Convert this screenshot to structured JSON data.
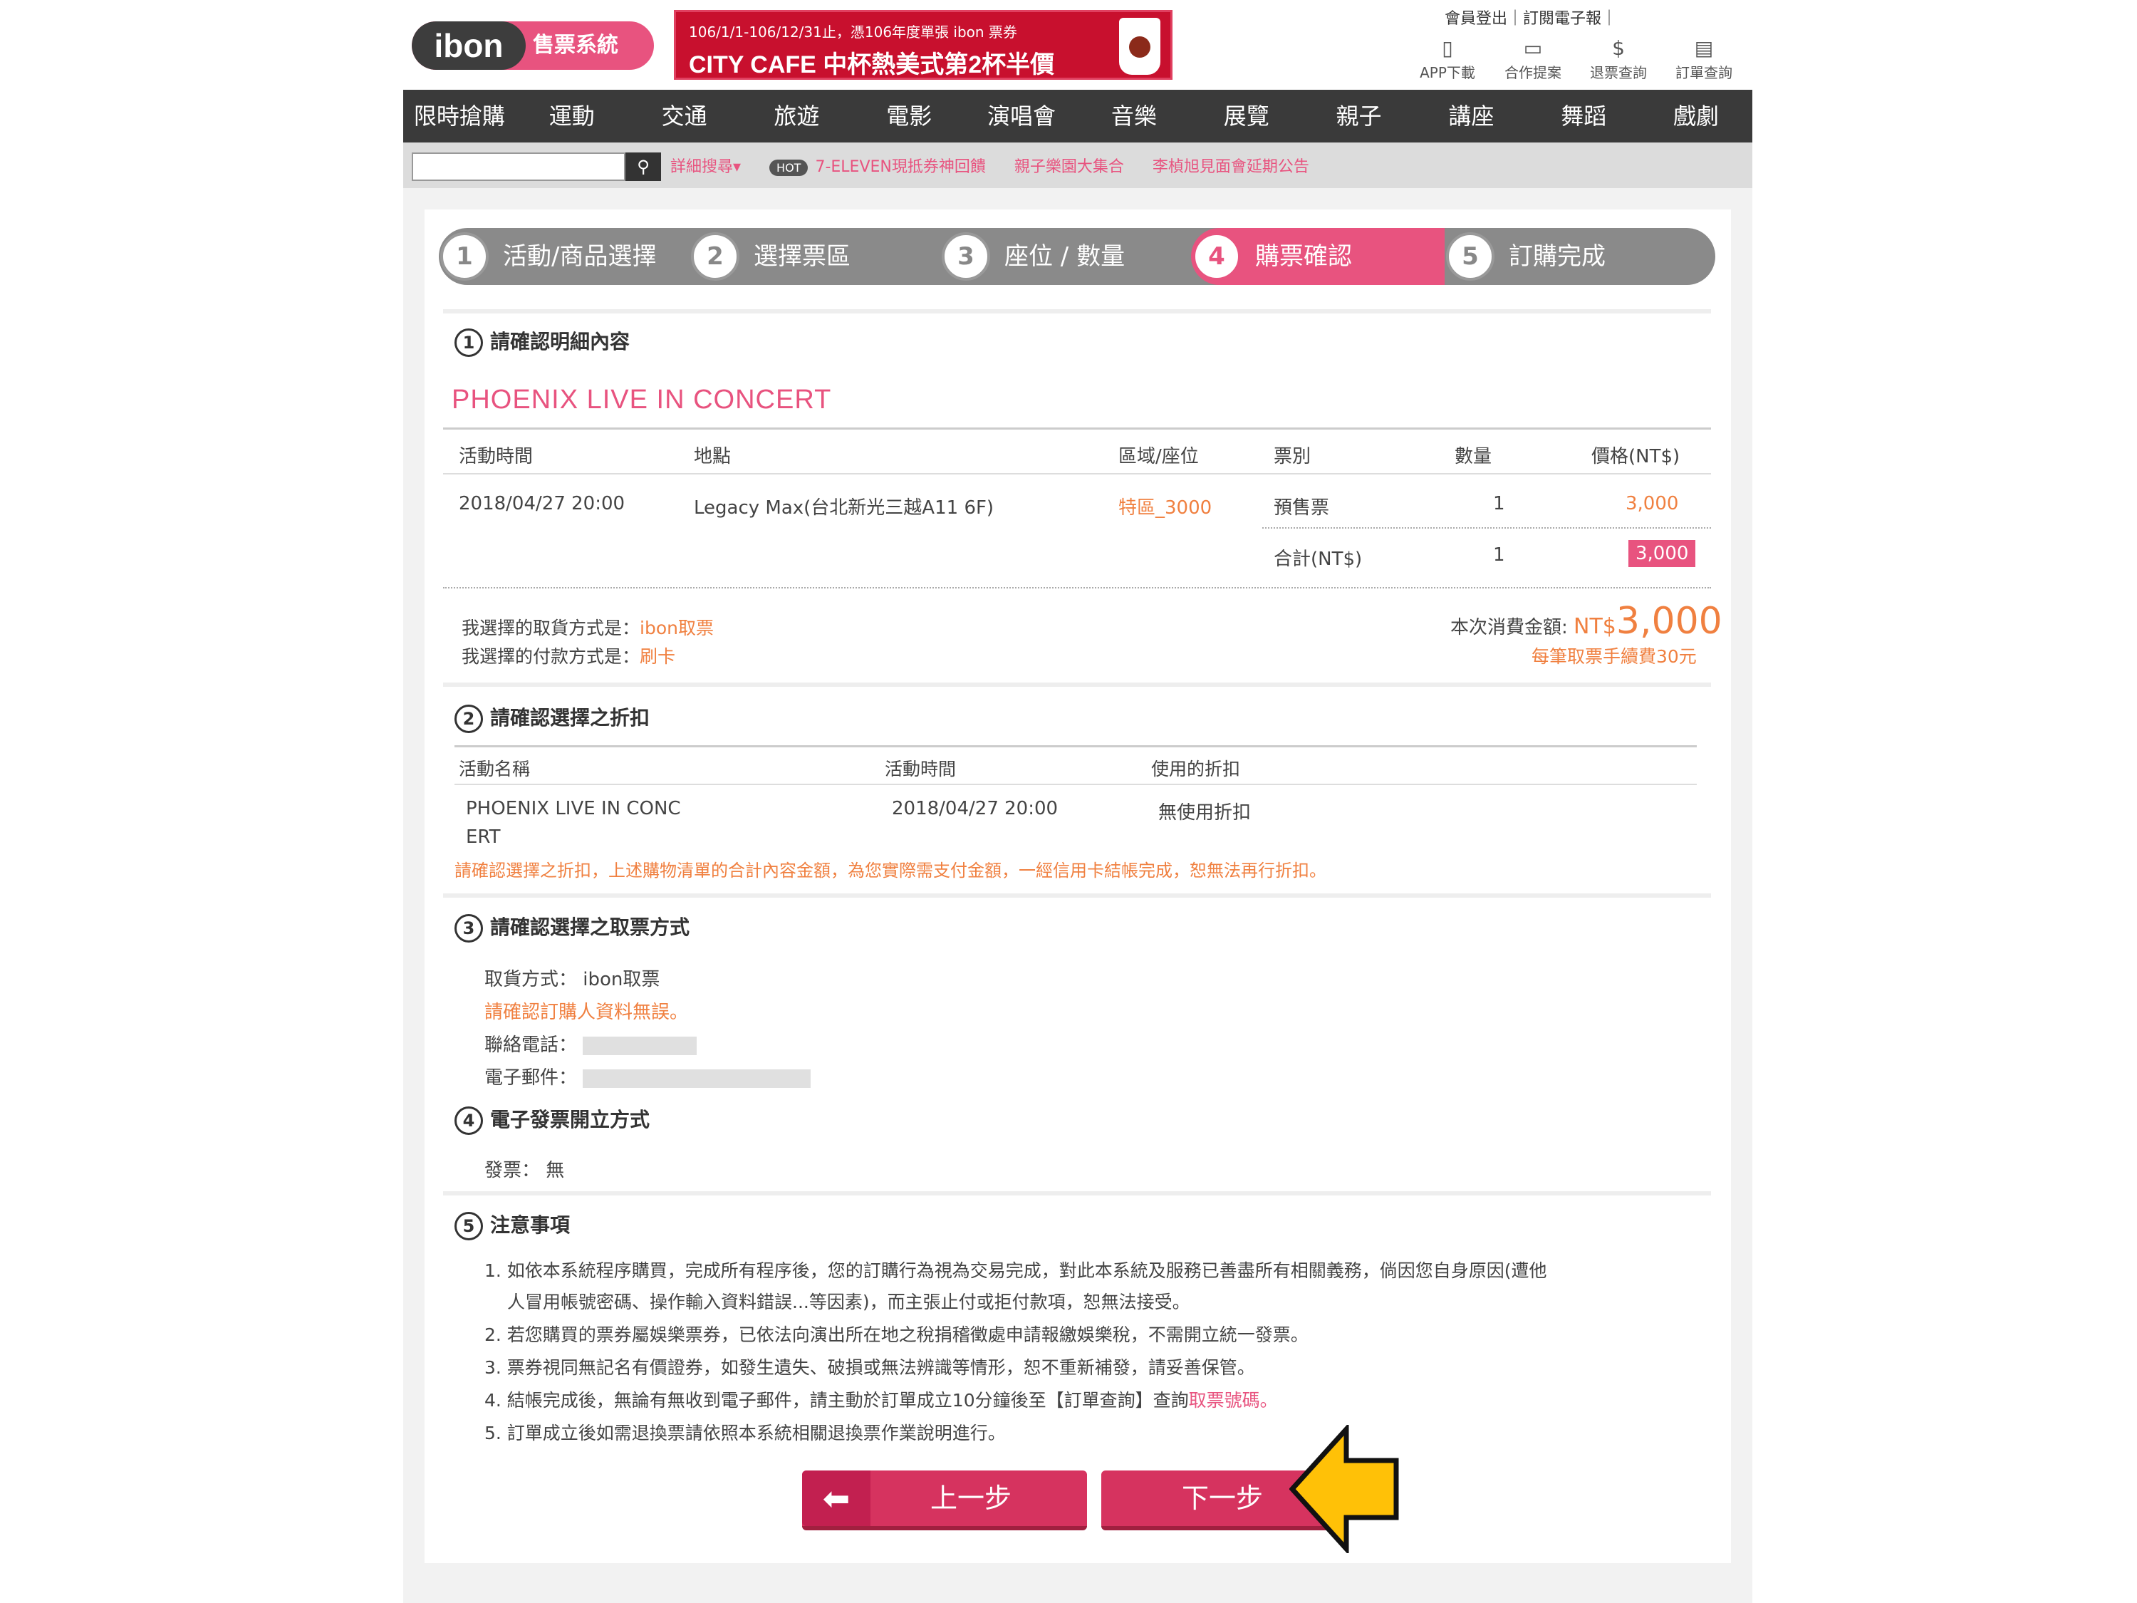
{
  "header": {
    "logo_ibon": "ibon",
    "logo_system": "售票系統",
    "banner_small": "106/1/1-106/12/31止，憑106年度單張 ibon 票券",
    "banner_big": "CITY CAFE 中杯熱美式第2杯半價",
    "top_links": "會員登出｜訂閱電子報｜",
    "top_icons": [
      {
        "icon": "phone-icon",
        "label": "APP下載"
      },
      {
        "icon": "briefcase-icon",
        "label": "合作提案"
      },
      {
        "icon": "refund-icon",
        "label": "退票查詢"
      },
      {
        "icon": "document-icon",
        "label": "訂單查詢"
      }
    ]
  },
  "nav": {
    "items": [
      "限時搶購",
      "運動",
      "交通",
      "旅遊",
      "電影",
      "演唱會",
      "音樂",
      "展覽",
      "親子",
      "講座",
      "舞蹈",
      "戲劇"
    ]
  },
  "search": {
    "placeholder": "",
    "advanced": "詳細搜尋▾",
    "hot_badge": "HOT",
    "links": [
      "7-ELEVEN現抵券神回饋",
      "親子樂園大集合",
      "李楨旭見面會延期公告"
    ]
  },
  "steps": [
    {
      "num": "1",
      "label": "活動/商品選擇"
    },
    {
      "num": "2",
      "label": "選擇票區"
    },
    {
      "num": "3",
      "label": "座位 / 數量"
    },
    {
      "num": "4",
      "label": "購票確認"
    },
    {
      "num": "5",
      "label": "訂購完成"
    }
  ],
  "section1": {
    "num": "1",
    "title": "請確認明細內容",
    "concert": "PHOENIX LIVE IN CONCERT",
    "headers": [
      "活動時間",
      "地點",
      "區域/座位",
      "票別",
      "數量",
      "價格(NT$)"
    ],
    "row": {
      "time": "2018/04/27 20:00",
      "venue": "Legacy Max(台北新光三越A11 6F)",
      "zone": "特區_3000",
      "type": "預售票",
      "qty": "1",
      "price": "3,000"
    },
    "total": {
      "label": "合計(NT$)",
      "qty": "1",
      "price": "3,000"
    },
    "pickup_label": "我選擇的取貨方式是：",
    "pickup_value": "ibon取票",
    "payment_label": "我選擇的付款方式是：",
    "payment_value": "刷卡",
    "amount_label": "本次消費金額:",
    "amount_currency": "NT$",
    "amount_value": "3,000",
    "fee_note": "每筆取票手續費30元"
  },
  "section2": {
    "num": "2",
    "title": "請確認選擇之折扣",
    "headers": [
      "活動名稱",
      "活動時間",
      "使用的折扣"
    ],
    "row_name_line1": "PHOENIX LIVE IN CONC",
    "row_name_line2": "ERT",
    "row_time": "2018/04/27 20:00",
    "row_discount": "無使用折扣",
    "warning": "請確認選擇之折扣，上述購物清單的合計內容金額，為您實際需支付金額，一經信用卡結帳完成，恕無法再行折扣。"
  },
  "section3": {
    "num": "3",
    "title": "請確認選擇之取票方式",
    "pickup": "取貨方式： ibon取票",
    "confirm_note": "請確認訂購人資料無誤。",
    "phone_label": "聯絡電話：",
    "email_label": "電子郵件："
  },
  "section4": {
    "num": "4",
    "title": "電子發票開立方式",
    "invoice": "發票： 無"
  },
  "section5": {
    "num": "5",
    "title": "注意事項",
    "notes": [
      "1. 如依本系統程序購買，完成所有程序後，您的訂購行為視為交易完成，對此本系統及服務已善盡所有相關義務，倘因您自身原因(遭他",
      "人冒用帳號密碼、操作輸入資料錯誤...等因素)，而主張止付或拒付款項，恕無法接受。",
      "2. 若您購買的票券屬娛樂票券，已依法向演出所在地之稅捐稽徵處申請報繳娛樂稅，不需開立統一發票。",
      "3. 票券視同無記名有價證券，如發生遺失、破損或無法辨識等情形，恕不重新補發，請妥善保管。",
      "4. 結帳完成後，無論有無收到電子郵件，請主動於訂單成立10分鐘後至【訂單查詢】查詢",
      "5. 訂單成立後如需退換票請依照本系統相關退換票作業說明進行。"
    ],
    "note4_highlight": "取票號碼。"
  },
  "buttons": {
    "prev": "上一步",
    "next": "下一步"
  }
}
